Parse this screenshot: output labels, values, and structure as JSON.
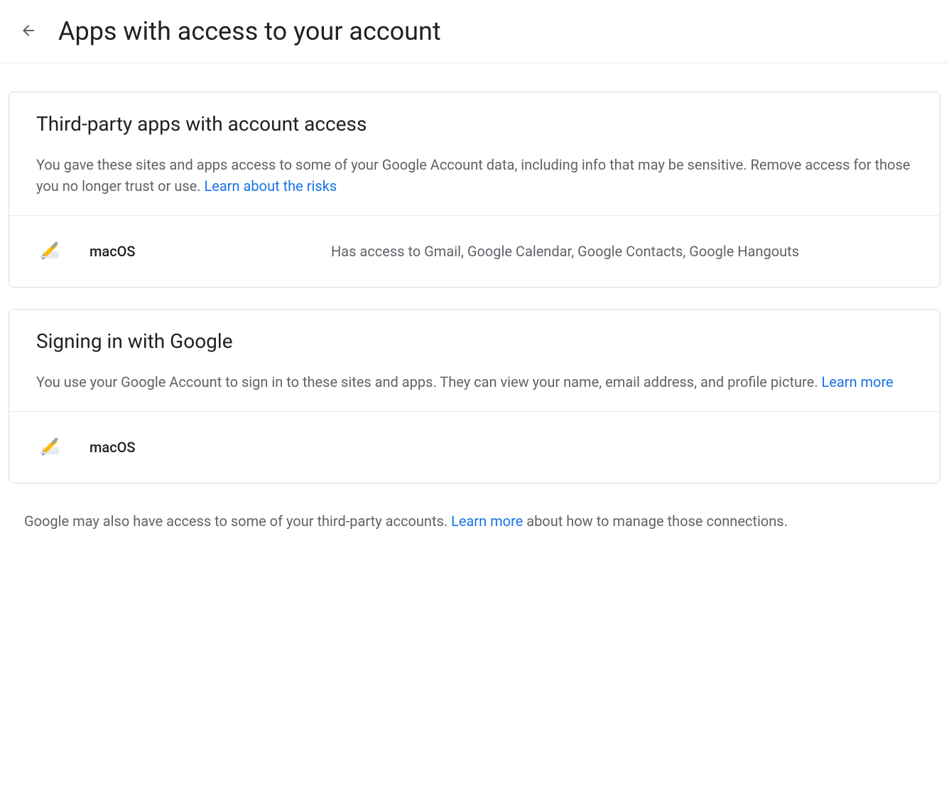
{
  "header": {
    "title": "Apps with access to your account"
  },
  "third_party": {
    "title": "Third-party apps with account access",
    "desc_prefix": "You gave these sites and apps access to some of your Google Account data, including info that may be sensitive. Remove access for those you no longer trust or use. ",
    "learn_link": "Learn about the risks",
    "apps": [
      {
        "name": "macOS",
        "access": "Has access to Gmail, Google Calendar, Google Contacts, Google Hangouts"
      }
    ]
  },
  "signin": {
    "title": "Signing in with Google",
    "desc_prefix": "You use your Google Account to sign in to these sites and apps. They can view your name, email address, and profile picture. ",
    "learn_link": "Learn more",
    "apps": [
      {
        "name": "macOS"
      }
    ]
  },
  "footer": {
    "prefix": "Google may also have access to some of your third-party accounts. ",
    "link": "Learn more",
    "suffix": " about how to manage those connections."
  }
}
